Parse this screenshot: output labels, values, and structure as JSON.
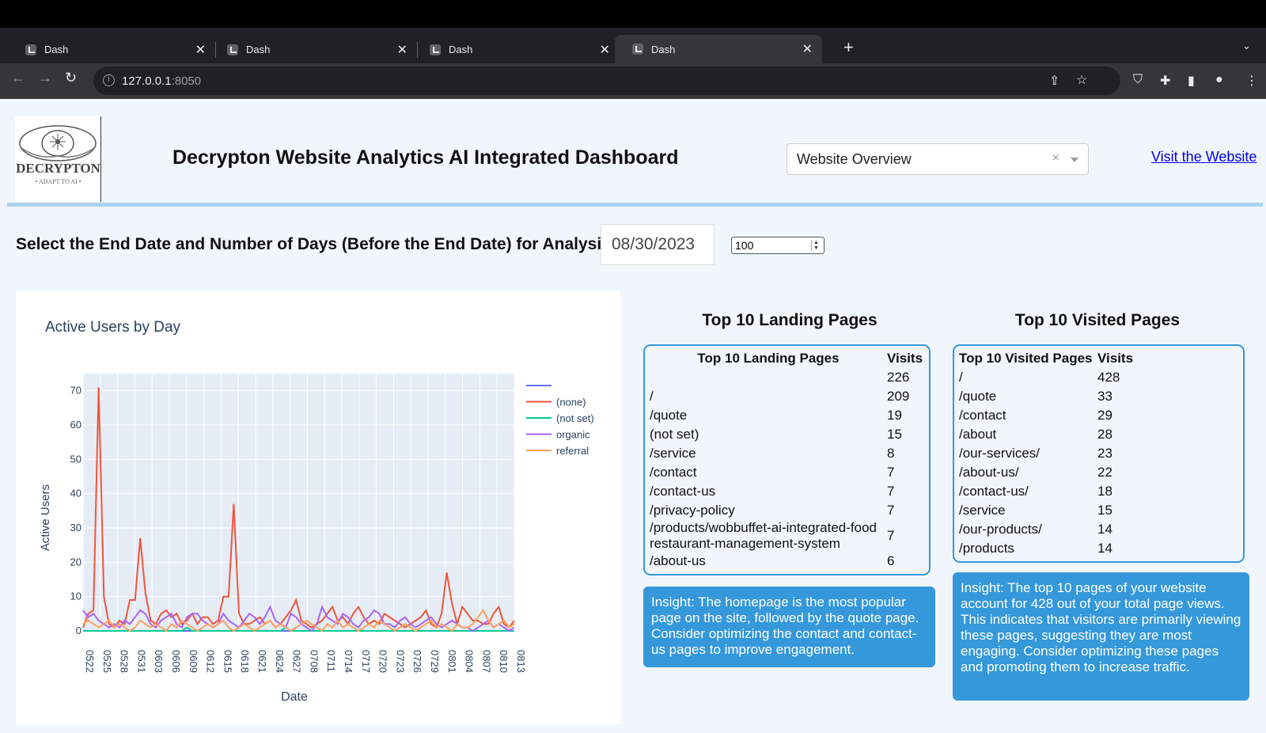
{
  "browser": {
    "tabs": [
      {
        "title": "Dash"
      },
      {
        "title": "Dash"
      },
      {
        "title": "Dash"
      },
      {
        "title": "Dash"
      }
    ],
    "url_host": "127.0.0.1",
    "url_port": ":8050"
  },
  "header": {
    "logo_text": "DECRYPTON",
    "logo_tagline": "• ADAPT TO AI •",
    "title": "Decrypton Website Analytics AI Integrated Dashboard",
    "dropdown_value": "Website Overview",
    "visit_link": "Visit the Website"
  },
  "controls": {
    "date_label": "Select the End Date and Number of Days (Before the End Date) for Analysis:",
    "end_date": "08/30/2023",
    "days": "100"
  },
  "chart_data": {
    "type": "line",
    "title": "Active Users by Day",
    "xlabel": "Date",
    "ylabel": "Active Users",
    "ylim": [
      0,
      75
    ],
    "yticks": [
      0,
      10,
      20,
      30,
      40,
      50,
      60,
      70
    ],
    "xticks": [
      "0522",
      "0525",
      "0528",
      "0531",
      "0603",
      "0606",
      "0609",
      "0612",
      "0615",
      "0618",
      "0621",
      "0624",
      "0627",
      "0708",
      "0711",
      "0714",
      "0717",
      "0720",
      "0723",
      "0726",
      "0729",
      "0801",
      "0804",
      "0807",
      "0810",
      "0813"
    ],
    "legend_position": "right",
    "grid": true,
    "series": [
      {
        "name": "",
        "color": "#636efa",
        "values": [
          0,
          0,
          0,
          0,
          0,
          0,
          0,
          0,
          0,
          0,
          0,
          0,
          0,
          0,
          0,
          0,
          0,
          0,
          0,
          0,
          0,
          0,
          0,
          0,
          0,
          0,
          0,
          0,
          0,
          0,
          0,
          0,
          0,
          0,
          0,
          0,
          0,
          0,
          0,
          0,
          0,
          0,
          0,
          0,
          0,
          0,
          0,
          0,
          0,
          0,
          0,
          0,
          0,
          0,
          0,
          0,
          0,
          0,
          0,
          0,
          0,
          0,
          0,
          0,
          0,
          0,
          0,
          0,
          0,
          0,
          0,
          0,
          0,
          0,
          0,
          0,
          0,
          0,
          0,
          0,
          0,
          0,
          0,
          0
        ]
      },
      {
        "name": "(none)",
        "color": "#ef553b",
        "values": [
          1,
          5,
          6,
          71,
          10,
          2,
          1,
          3,
          2,
          9,
          9,
          27,
          11,
          3,
          2,
          5,
          6,
          4,
          5,
          2,
          3,
          5,
          2,
          4,
          4,
          2,
          3,
          10,
          10,
          37,
          5,
          2,
          2,
          3,
          4,
          2,
          3,
          1,
          2,
          4,
          6,
          9,
          3,
          2,
          1,
          2,
          3,
          5,
          7,
          3,
          4,
          2,
          5,
          7,
          4,
          2,
          3,
          2,
          5,
          4,
          3,
          2,
          1,
          2,
          3,
          4,
          6,
          2,
          1,
          5,
          17,
          8,
          2,
          7,
          5,
          3,
          3,
          2,
          2,
          5,
          7,
          2,
          1,
          3
        ]
      },
      {
        "name": "(not set)",
        "color": "#00cc96",
        "values": [
          0,
          0,
          0,
          0,
          0,
          0,
          0,
          0,
          0,
          0,
          0,
          0,
          0,
          0,
          0,
          0,
          0,
          0,
          0,
          0,
          1,
          0,
          0,
          0,
          0,
          0,
          0,
          0,
          0,
          0,
          0,
          0,
          0,
          0,
          0,
          0,
          0,
          0,
          0,
          1,
          0,
          0,
          0,
          0,
          0,
          0,
          0,
          0,
          0,
          0,
          0,
          0,
          0,
          0,
          0,
          0,
          0,
          0,
          0,
          0,
          0,
          0,
          0,
          0,
          0,
          0,
          0,
          0,
          0,
          0,
          0,
          0,
          0,
          0,
          0,
          0,
          0,
          0,
          0,
          0,
          0,
          0,
          0,
          0
        ]
      },
      {
        "name": "organic",
        "color": "#ab63fa",
        "values": [
          6,
          4,
          5,
          3,
          2,
          1,
          2,
          1,
          3,
          2,
          4,
          6,
          5,
          2,
          1,
          3,
          4,
          5,
          2,
          1,
          4,
          5,
          5,
          3,
          2,
          1,
          2,
          5,
          3,
          2,
          1,
          3,
          5,
          4,
          2,
          4,
          7,
          3,
          2,
          1,
          5,
          4,
          2,
          1,
          0,
          2,
          7,
          4,
          3,
          2,
          5,
          4,
          2,
          1,
          3,
          4,
          6,
          5,
          2,
          2,
          1,
          3,
          4,
          2,
          1,
          2,
          3,
          4,
          2,
          1,
          2,
          3,
          2,
          1,
          1,
          0,
          1,
          2,
          3,
          1,
          2,
          1,
          0,
          1
        ]
      },
      {
        "name": "referral",
        "color": "#ffa15a",
        "values": [
          2,
          3,
          2,
          1,
          2,
          3,
          1,
          2,
          1,
          0,
          1,
          3,
          2,
          1,
          2,
          1,
          0,
          2,
          1,
          3,
          2,
          1,
          0,
          1,
          2,
          1,
          2,
          3,
          1,
          0,
          1,
          2,
          1,
          0,
          1,
          2,
          3,
          1,
          2,
          1,
          0,
          1,
          2,
          3,
          2,
          1,
          0,
          2,
          1,
          3,
          1,
          2,
          1,
          0,
          1,
          2,
          1,
          3,
          2,
          1,
          0,
          1,
          2,
          1,
          0,
          1,
          2,
          3,
          1,
          2,
          1,
          0,
          2,
          1,
          1,
          2,
          4,
          6,
          3,
          1,
          2,
          3,
          1,
          2
        ]
      }
    ]
  },
  "landing": {
    "section_title": "Top 10 Landing Pages",
    "col_page": "Top 10 Landing Pages",
    "col_visits": "Visits",
    "rows": [
      {
        "page": "",
        "visits": "226"
      },
      {
        "page": "/",
        "visits": "209"
      },
      {
        "page": "/quote",
        "visits": "19"
      },
      {
        "page": "(not set)",
        "visits": "15"
      },
      {
        "page": "/service",
        "visits": "8"
      },
      {
        "page": "/contact",
        "visits": "7"
      },
      {
        "page": "/contact-us",
        "visits": "7"
      },
      {
        "page": "/privacy-policy",
        "visits": "7"
      },
      {
        "page": "/products/wobbuffet-ai-integrated-foodrestaurant-management-system",
        "visits": "7"
      },
      {
        "page": "/about-us",
        "visits": "6"
      }
    ],
    "insight": "Insight: The homepage is the most popular page on the site, followed by the quote page. Consider optimizing the contact and contact-us pages to improve engagement."
  },
  "visited": {
    "section_title": "Top 10 Visited Pages",
    "col_page": "Top 10 Visited Pages",
    "col_visits": "Visits",
    "rows": [
      {
        "page": "/",
        "visits": "428"
      },
      {
        "page": "/quote",
        "visits": "33"
      },
      {
        "page": "/contact",
        "visits": "29"
      },
      {
        "page": "/about",
        "visits": "28"
      },
      {
        "page": "/our-services/",
        "visits": "23"
      },
      {
        "page": "/about-us/",
        "visits": "22"
      },
      {
        "page": "/contact-us/",
        "visits": "18"
      },
      {
        "page": "/service",
        "visits": "15"
      },
      {
        "page": "/our-products/",
        "visits": "14"
      },
      {
        "page": "/products",
        "visits": "14"
      }
    ],
    "insight": "Insight: The top 10 pages of your website account for 428 out of your total page views. This indicates that visitors are primarily viewing these pages, suggesting they are most engaging. Consider optimizing these pages and promoting them to increase traffic."
  }
}
